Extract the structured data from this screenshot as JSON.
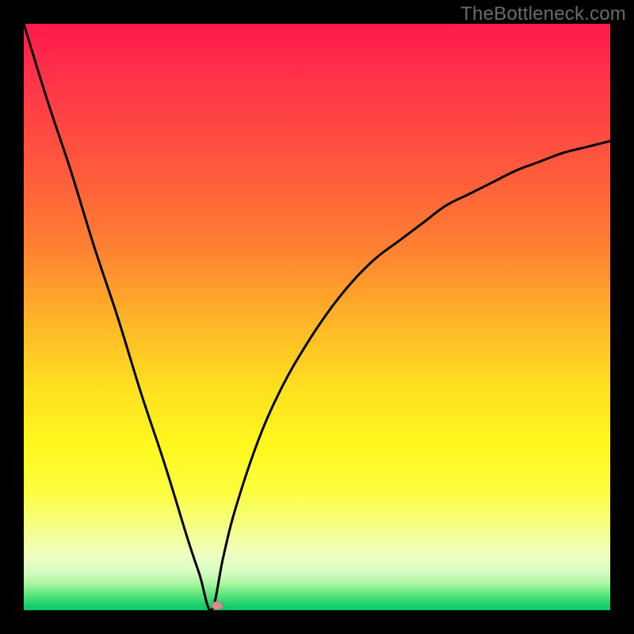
{
  "watermark": "TheBottleneck.com",
  "plot": {
    "margin": 30,
    "size": 740
  },
  "gradient_stops": [
    {
      "offset": 0.0,
      "color": "#ff1a4b"
    },
    {
      "offset": 0.12,
      "color": "#ff3a47"
    },
    {
      "offset": 0.25,
      "color": "#ff5a3c"
    },
    {
      "offset": 0.38,
      "color": "#ff8032"
    },
    {
      "offset": 0.5,
      "color": "#ffb228"
    },
    {
      "offset": 0.62,
      "color": "#ffe020"
    },
    {
      "offset": 0.72,
      "color": "#fff81e"
    },
    {
      "offset": 0.8,
      "color": "#fdfe40"
    },
    {
      "offset": 0.86,
      "color": "#f4fe8a"
    },
    {
      "offset": 0.905,
      "color": "#f0fec0"
    },
    {
      "offset": 0.935,
      "color": "#d6fcc4"
    },
    {
      "offset": 0.955,
      "color": "#a8f7a0"
    },
    {
      "offset": 0.975,
      "color": "#56e47a"
    },
    {
      "offset": 0.992,
      "color": "#18cf6a"
    },
    {
      "offset": 1.0,
      "color": "#0fc866"
    }
  ],
  "marker": {
    "x_frac": 0.33,
    "y_frac": 0.992,
    "rx": 7,
    "ry": 5,
    "fill": "#d58e8c",
    "stroke": "#b86f6d"
  },
  "chart_data": {
    "type": "line",
    "title": "",
    "xlabel": "",
    "ylabel": "",
    "xlim": [
      0,
      100
    ],
    "ylim": [
      0,
      100
    ],
    "grid": false,
    "legend": false,
    "note": "Curve minimum at x≈32, y≈0. Left branch rises steeply to y=100 at x=0; right branch rises to y≈80 at x=100.",
    "series": [
      {
        "name": "curve",
        "x": [
          0,
          4,
          8,
          12,
          16,
          20,
          24,
          28,
          30,
          32,
          34,
          36,
          40,
          44,
          48,
          52,
          56,
          60,
          64,
          68,
          72,
          76,
          80,
          84,
          88,
          92,
          96,
          100
        ],
        "y": [
          100,
          87,
          75,
          62,
          50,
          37,
          25,
          12,
          6,
          0,
          9,
          17,
          29,
          38,
          45,
          51,
          56,
          60,
          63,
          66,
          69,
          71,
          73,
          75,
          76.5,
          78,
          79,
          80
        ]
      }
    ],
    "marker_points": [
      {
        "x": 33,
        "y": 0.8
      }
    ]
  }
}
